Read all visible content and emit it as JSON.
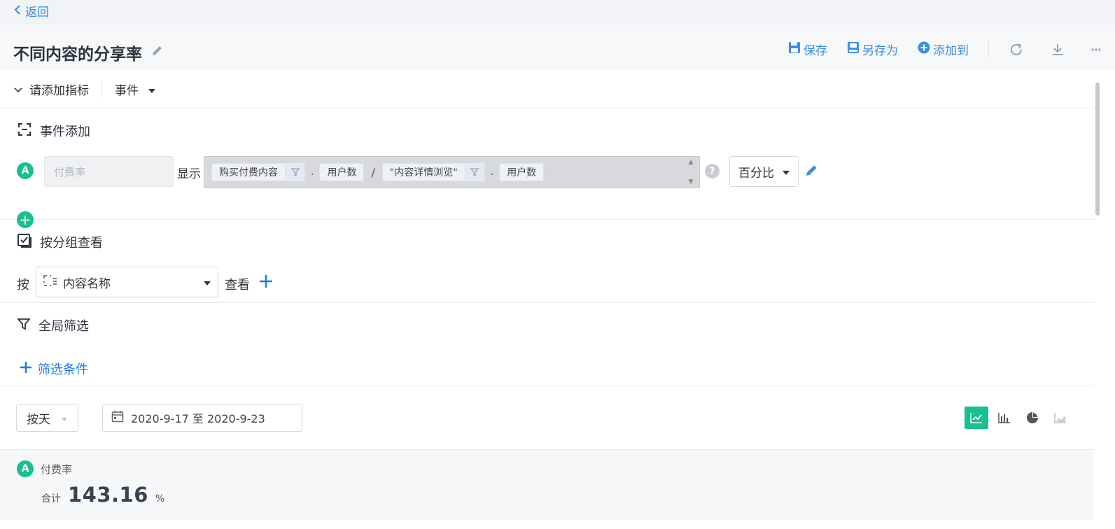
{
  "nav": {
    "back_label": "返回"
  },
  "header": {
    "title": "不同内容的分享率",
    "save_label": "保存",
    "save_as_label": "另存为",
    "add_to_label": "添加到"
  },
  "metric_bar": {
    "toggle_label": "请添加指标",
    "event_dropdown": "事件"
  },
  "event_section": {
    "title": "事件添加",
    "badge": "A",
    "name_placeholder": "付费率",
    "show_label": "显示",
    "formula": {
      "part1_event": "购买付费内容",
      "dot1": ".",
      "part1_measure": "用户数",
      "op": "/",
      "part2_event": "\"内容详情浏览\"",
      "dot2": ".",
      "part2_measure": "用户数"
    },
    "format": "百分比"
  },
  "group_section": {
    "title": "按分组查看",
    "by_label": "按",
    "group_field": "内容名称",
    "view_label": "查看"
  },
  "filter_section": {
    "title": "全局筛选",
    "add_condition": "筛选条件"
  },
  "controls": {
    "granularity": "按天",
    "date_range": "2020-9-17 至 2020-9-23"
  },
  "summary": {
    "badge": "A",
    "metric_name": "付费率",
    "total_label": "合计",
    "total_value": "143.16",
    "unit": "%"
  },
  "colors": {
    "accent_green": "#18c08f",
    "accent_blue": "#3a8ee6"
  }
}
